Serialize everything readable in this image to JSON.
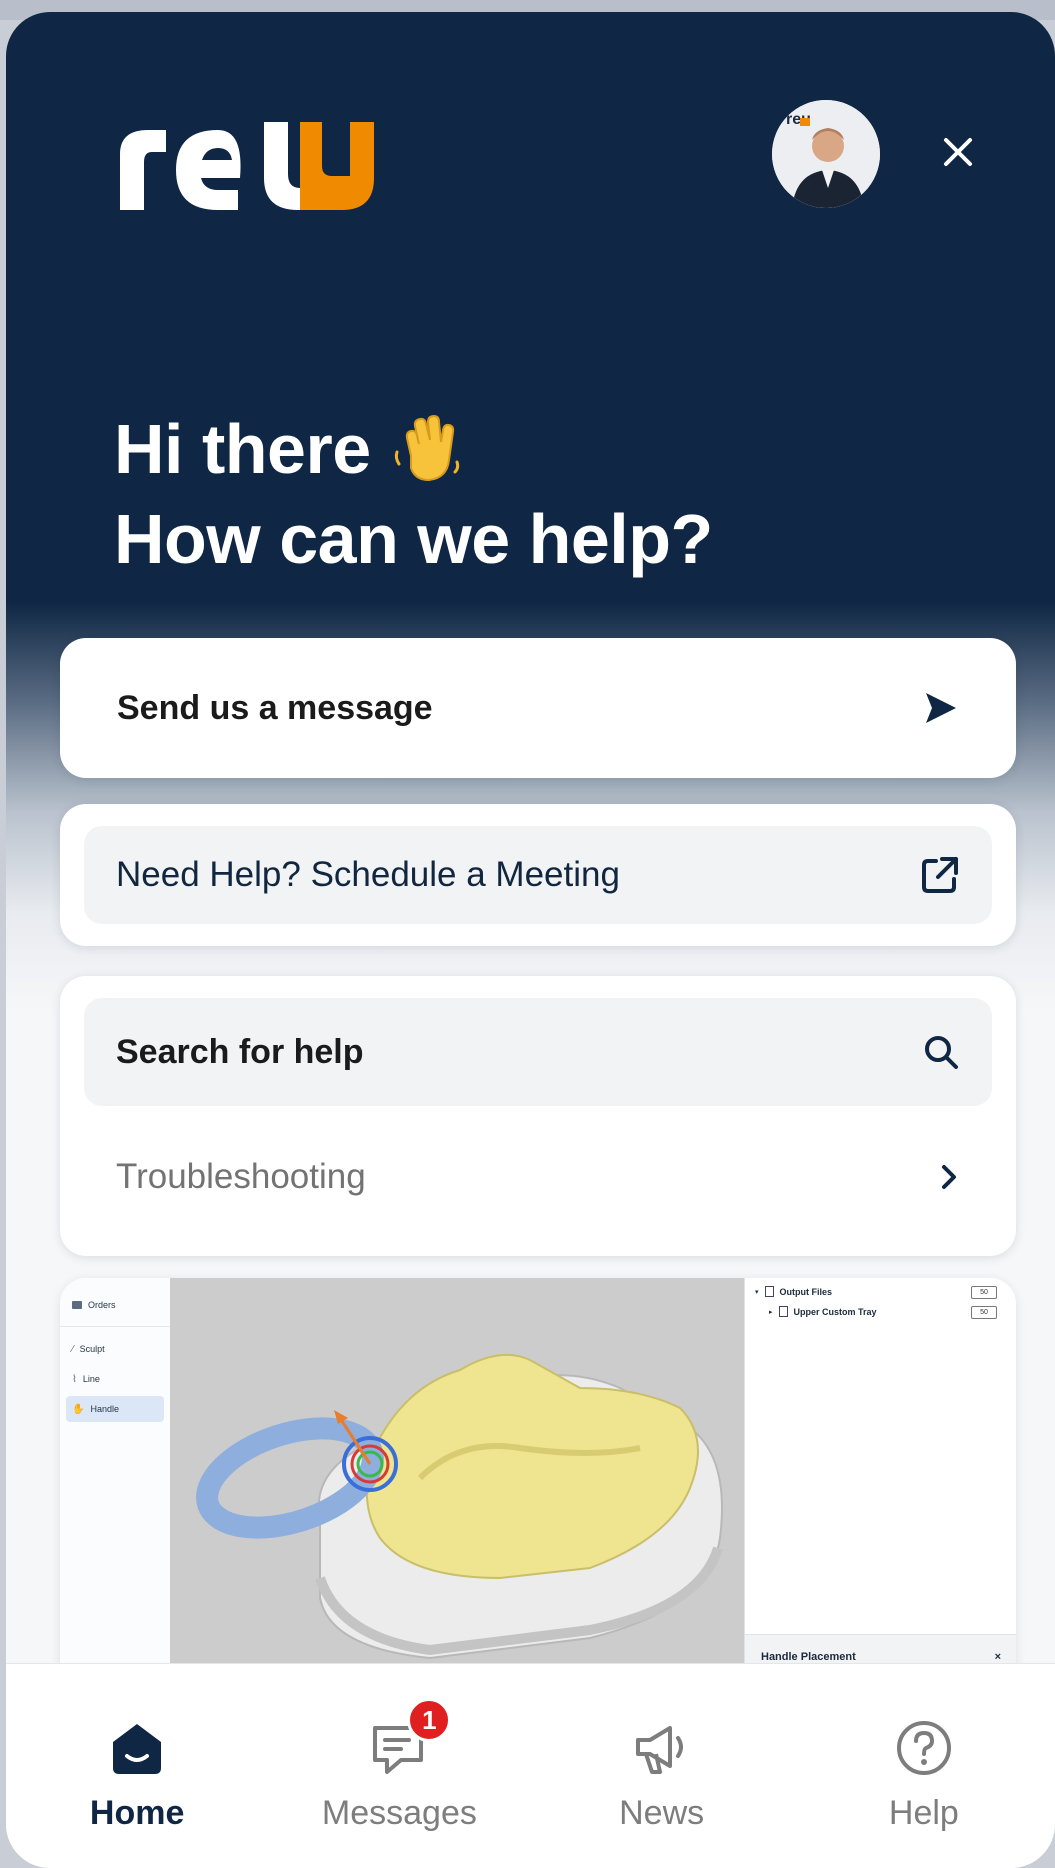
{
  "brand": {
    "name": "reu",
    "primary_color": "#0f2744",
    "accent_color": "#f08a00"
  },
  "header": {
    "avatar_alt": "Support agent",
    "close_icon": "close-icon"
  },
  "greeting": {
    "line1": "Hi there",
    "emoji": "waving-hand",
    "line2": "How can we help?"
  },
  "send_message": {
    "label": "Send us a message",
    "icon": "send-arrow-icon"
  },
  "meeting": {
    "label": "Need Help? Schedule a Meeting",
    "icon": "external-link-icon"
  },
  "search": {
    "label": "Search for help",
    "icon": "search-icon"
  },
  "links": [
    {
      "label": "Troubleshooting",
      "icon": "chevron-right-icon"
    }
  ],
  "preview": {
    "sidebar": {
      "header": "Orders",
      "items": [
        "Sculpt",
        "Line",
        "Handle"
      ],
      "active": "Handle"
    },
    "panel": {
      "tree": [
        "Output Files",
        "Upper Custom Tray"
      ],
      "badge": "50",
      "footer": "Handle Placement",
      "close": "×"
    }
  },
  "tabs": [
    {
      "label": "Home",
      "icon": "home-icon",
      "active": true
    },
    {
      "label": "Messages",
      "icon": "messages-icon",
      "badge": "1"
    },
    {
      "label": "News",
      "icon": "megaphone-icon"
    },
    {
      "label": "Help",
      "icon": "help-icon"
    }
  ]
}
